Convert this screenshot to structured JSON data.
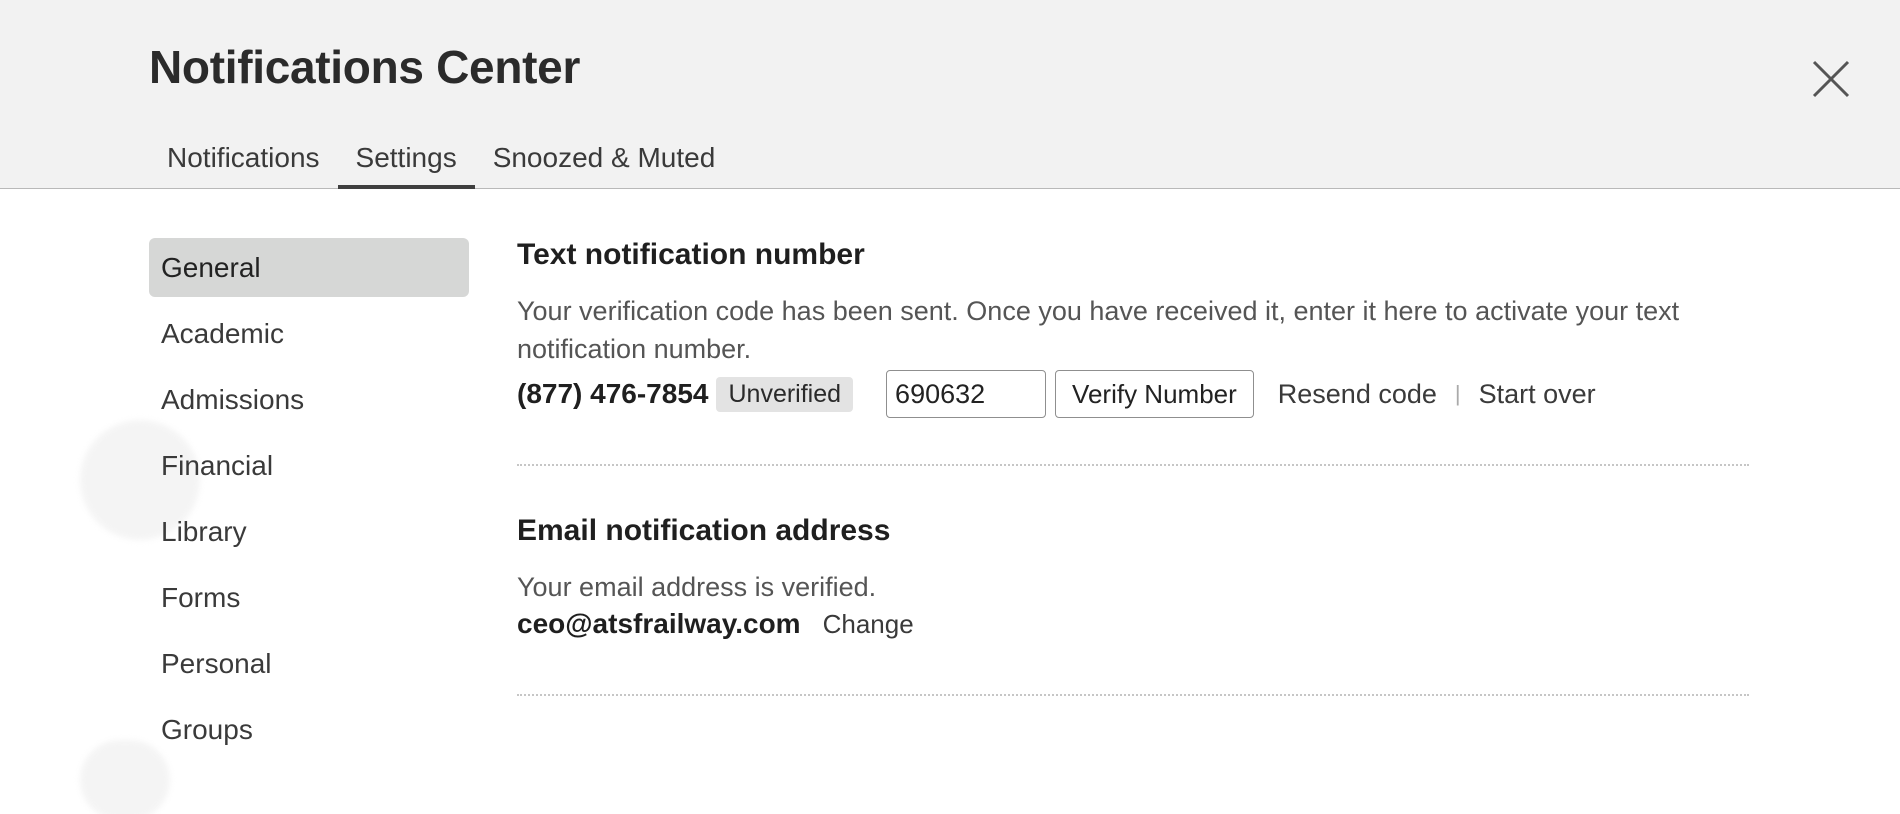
{
  "header": {
    "title": "Notifications Center",
    "close_icon": "close-icon"
  },
  "tabs": [
    {
      "label": "Notifications",
      "active": false
    },
    {
      "label": "Settings",
      "active": true
    },
    {
      "label": "Snoozed & Muted",
      "active": false
    }
  ],
  "sidebar": {
    "items": [
      {
        "label": "General",
        "active": true
      },
      {
        "label": "Academic",
        "active": false
      },
      {
        "label": "Admissions",
        "active": false
      },
      {
        "label": "Financial",
        "active": false
      },
      {
        "label": "Library",
        "active": false
      },
      {
        "label": "Forms",
        "active": false
      },
      {
        "label": "Personal",
        "active": false
      },
      {
        "label": "Groups",
        "active": false
      }
    ]
  },
  "text_notification": {
    "title": "Text notification number",
    "description": "Your verification code has been sent. Once you have received it, enter it here to activate your text notification number.",
    "phone": "(877) 476-7854",
    "status_badge": "Unverified",
    "code_value": "690632",
    "verify_label": "Verify Number",
    "resend_label": "Resend code",
    "separator": "|",
    "start_over_label": "Start over"
  },
  "email_notification": {
    "title": "Email notification address",
    "description": "Your email address is verified.",
    "email": "ceo@atsfrailway.com",
    "change_label": "Change"
  },
  "colors": {
    "header_bg": "#f2f2f2",
    "active_sidebar_bg": "#d6d7d6",
    "badge_bg": "#e3e3e3",
    "tab_underline": "#3f3f3f"
  }
}
